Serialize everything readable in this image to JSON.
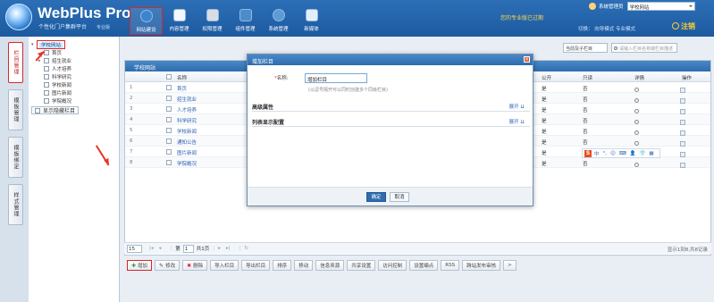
{
  "header": {
    "logo_title": "WebPlus Pro",
    "logo_subtitle": "个性化门户集群平台",
    "edition": "专业版",
    "nav": [
      {
        "label": "网站建设",
        "icon": "globe-icon"
      },
      {
        "label": "内容管理",
        "icon": "document-icon"
      },
      {
        "label": "权限管理",
        "icon": "lock-icon"
      },
      {
        "label": "组件管理",
        "icon": "puzzle-icon"
      },
      {
        "label": "系统管理",
        "icon": "gear-icon"
      },
      {
        "label": "新媒体",
        "icon": "media-icon"
      }
    ],
    "promo": "您的专业版已过期",
    "admin_label": "系统管理员",
    "site_select": "学校网站",
    "mode_links": "切换：  向导模式   专业模式",
    "logout": "注销"
  },
  "vtabs": [
    "栏目管理",
    "模板管理",
    "模板绑定",
    "样式管理"
  ],
  "tree": {
    "root": "学校网站",
    "items": [
      "首页",
      "招生就业",
      "人才培养",
      "科学研究",
      "学校新闻",
      "图片新闻",
      "学院概况"
    ],
    "hidden_toggle": "显示隐藏栏目"
  },
  "search": {
    "scope": "当前及子栏目",
    "placeholder": "请输入栏目名称或栏目描述"
  },
  "grid": {
    "title": "学校网站",
    "columns": {
      "name": "名称",
      "public": "公开",
      "readonly": "只读",
      "detail": "详情",
      "operation": "操作"
    },
    "rows": [
      {
        "num": "1",
        "name": "首页",
        "public": "是",
        "readonly": "否"
      },
      {
        "num": "2",
        "name": "招生就业",
        "public": "是",
        "readonly": "否"
      },
      {
        "num": "3",
        "name": "人才培养",
        "public": "是",
        "readonly": "否"
      },
      {
        "num": "4",
        "name": "科学研究",
        "public": "是",
        "readonly": "否"
      },
      {
        "num": "5",
        "name": "学校新闻",
        "public": "是",
        "readonly": "否"
      },
      {
        "num": "6",
        "name": "通知公告",
        "public": "是",
        "readonly": "否"
      },
      {
        "num": "7",
        "name": "图片新闻",
        "public": "是",
        "readonly": "否"
      },
      {
        "num": "8",
        "name": "学院概况",
        "public": "是",
        "readonly": "否"
      }
    ]
  },
  "ime": {
    "logo": "S",
    "glyphs": [
      "中",
      "°,",
      "☺",
      "⌨",
      "👤",
      "👕",
      "▦"
    ]
  },
  "pager": {
    "page_size": "15",
    "page_prefix": "第",
    "page_value": "1",
    "page_total": "共1页",
    "info": "显示1到8,共8记录"
  },
  "actions": [
    "增加",
    "修改",
    "删除",
    "导入栏目",
    "导出栏目",
    "排序",
    "移动",
    "信息来源",
    "共享设置",
    "访问控制",
    "设置编点",
    "RSS",
    "跨站发布审核",
    ">"
  ],
  "action_icons": [
    "✚",
    "✎",
    "✖",
    "",
    "",
    "",
    "",
    "",
    "",
    "",
    "",
    "",
    "",
    ""
  ],
  "modal": {
    "title": "增加栏目",
    "field_label": "名称:",
    "field_value": "增加栏目",
    "hint": "(以逗号隔开可以同时创建多个同级栏目)",
    "sections": [
      {
        "label": "高级属性",
        "expand": "展开"
      },
      {
        "label": "列表显示配置",
        "expand": "展开"
      }
    ],
    "ok": "确定",
    "cancel": "取消"
  },
  "colors": {
    "header": "#2c6fb6",
    "accent_red": "#d9262b",
    "link": "#2b5fb2"
  }
}
